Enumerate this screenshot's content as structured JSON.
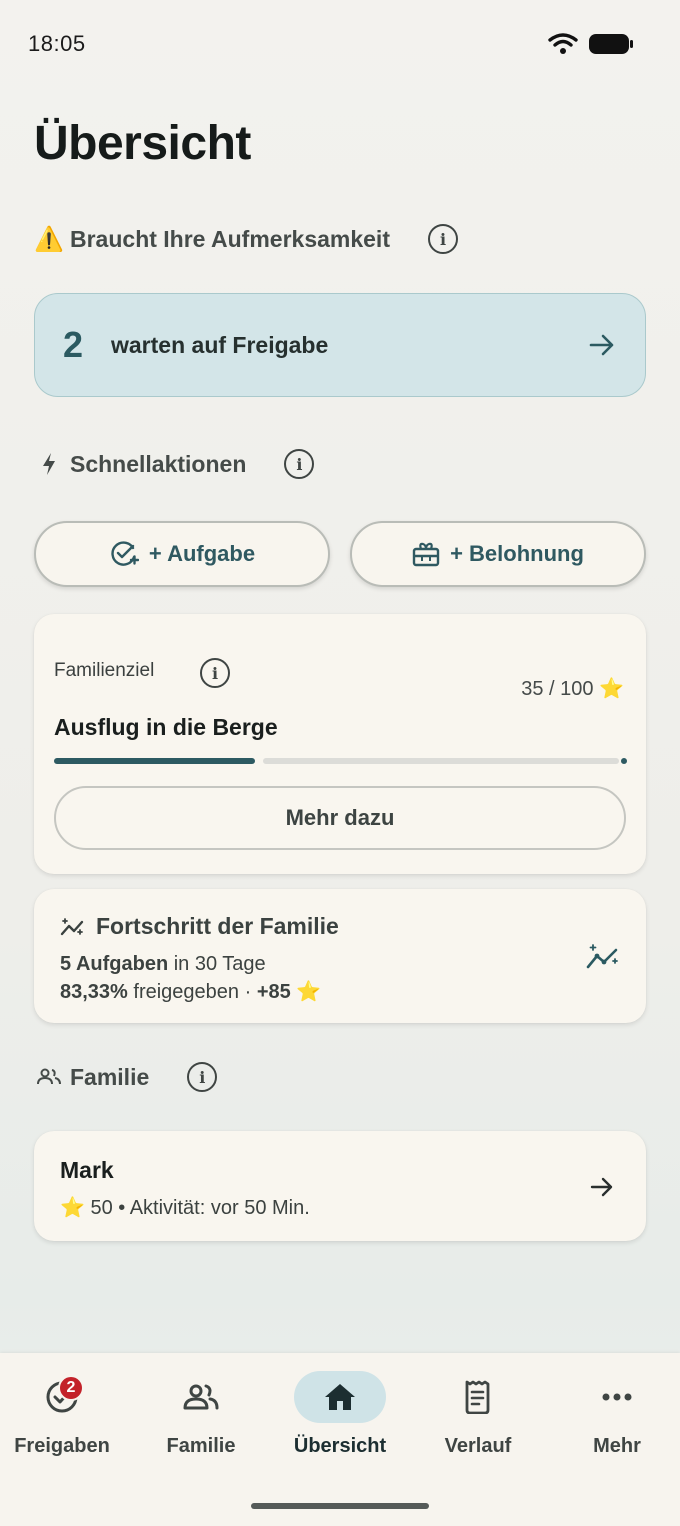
{
  "status_bar": {
    "time": "18:05"
  },
  "page": {
    "title": "Übersicht"
  },
  "attention": {
    "heading": "Braucht Ihre Aufmerksamkeit",
    "warning_emoji": "⚠️",
    "count": "2",
    "label": "warten auf Freigabe"
  },
  "quick_actions": {
    "heading": "Schnellaktionen",
    "add_task": "+ Aufgabe",
    "add_reward": "+ Belohnung"
  },
  "family_goal": {
    "label": "Familienziel",
    "progress_text": "35 / 100 ⭐",
    "progress_fraction": 0.35,
    "name": "Ausflug in die Berge",
    "more_button": "Mehr dazu"
  },
  "family_progress": {
    "title": "Fortschritt der Familie",
    "tasks_bold": "5 Aufgaben",
    "tasks_rest": " in 30 Tage",
    "approved_bold": "83,33%",
    "approved_rest": " freigegeben · ",
    "stars_bold": "+85",
    "stars_emoji": " ⭐"
  },
  "family": {
    "heading": "Familie",
    "members": [
      {
        "name": "Mark",
        "meta": "⭐ 50 • Aktivität: vor 50 Min."
      }
    ]
  },
  "bottom_nav": {
    "items": [
      {
        "label": "Freigaben",
        "badge": "2"
      },
      {
        "label": "Familie"
      },
      {
        "label": "Übersicht"
      },
      {
        "label": "Verlauf"
      },
      {
        "label": "Mehr"
      }
    ],
    "active_index": 2
  },
  "colors": {
    "accent": "#2d5a62",
    "attention_bg": "#d3e5e8",
    "badge": "#c3222a"
  }
}
